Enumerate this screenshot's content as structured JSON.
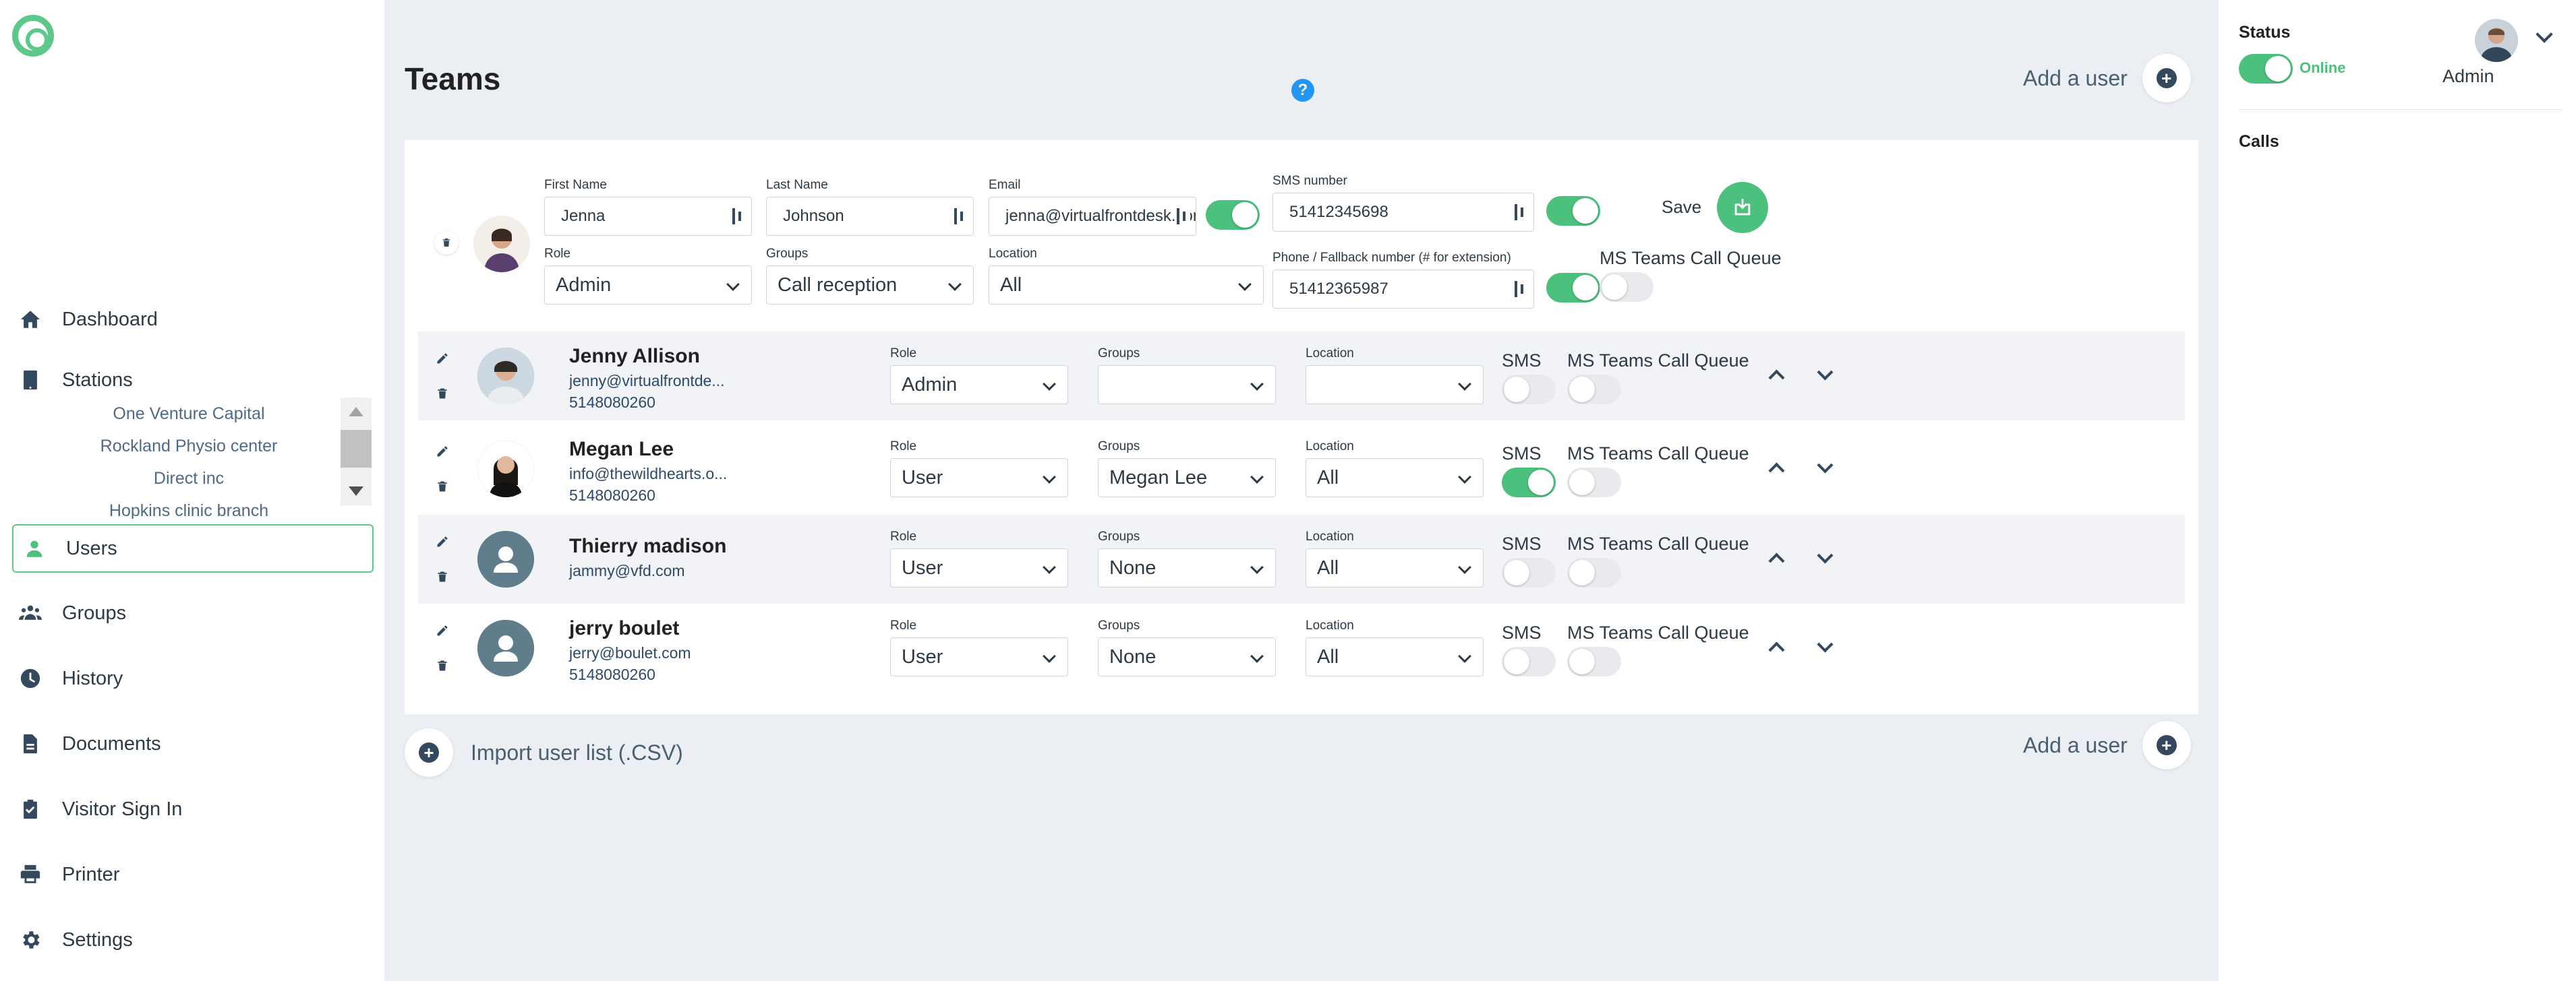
{
  "sidebar": {
    "items": [
      {
        "label": "Dashboard"
      },
      {
        "label": "Stations"
      },
      {
        "label": "Users"
      },
      {
        "label": "Groups"
      },
      {
        "label": "History"
      },
      {
        "label": "Documents"
      },
      {
        "label": "Visitor Sign In"
      },
      {
        "label": "Printer"
      },
      {
        "label": "Settings"
      }
    ],
    "stations": [
      "One Venture Capital",
      "Rockland Physio center",
      "Direct inc",
      "Hopkins clinic branch"
    ]
  },
  "main": {
    "title": "Teams",
    "help": "?",
    "add_user_label": "Add a user",
    "import_label": "Import user list (.CSV)",
    "colors": {
      "accent": "#4cc07d",
      "help": "#2196f3"
    }
  },
  "editor": {
    "first_name_label": "First Name",
    "first_name": "Jenna",
    "last_name_label": "Last Name",
    "last_name": "Johnson",
    "email_label": "Email",
    "email": "jenna@virtualfrontdesk.com",
    "sms_label": "SMS number",
    "sms": "51412345698",
    "role_label": "Role",
    "role": "Admin",
    "groups_label": "Groups",
    "groups": "Call reception",
    "location_label": "Location",
    "location": "All",
    "phone_label": "Phone / Fallback number (# for extension)",
    "phone": "51412365987",
    "queue_label": "MS Teams Call Queue",
    "save_label": "Save"
  },
  "labels": {
    "role": "Role",
    "groups": "Groups",
    "location": "Location",
    "sms": "SMS",
    "queue": "MS Teams Call Queue"
  },
  "users": [
    {
      "name": "Jenny Allison",
      "email": "jenny@virtualfrontde...",
      "phone": "5148080260",
      "role": "Admin",
      "groups": "",
      "location": "",
      "sms": false,
      "queue": false
    },
    {
      "name": "Megan Lee",
      "email": "info@thewildhearts.o...",
      "phone": "5148080260",
      "role": "User",
      "groups": "Megan Lee",
      "location": "All",
      "sms": true,
      "queue": false
    },
    {
      "name": "Thierry madison",
      "email": "jammy@vfd.com",
      "phone": "",
      "role": "User",
      "groups": "None",
      "location": "All",
      "sms": false,
      "queue": false
    },
    {
      "name": "jerry boulet",
      "email": "jerry@boulet.com",
      "phone": "5148080260",
      "role": "User",
      "groups": "None",
      "location": "All",
      "sms": false,
      "queue": false
    }
  ],
  "status_panel": {
    "status_label": "Status",
    "online_label": "Online",
    "user_role": "Admin",
    "calls_label": "Calls"
  }
}
